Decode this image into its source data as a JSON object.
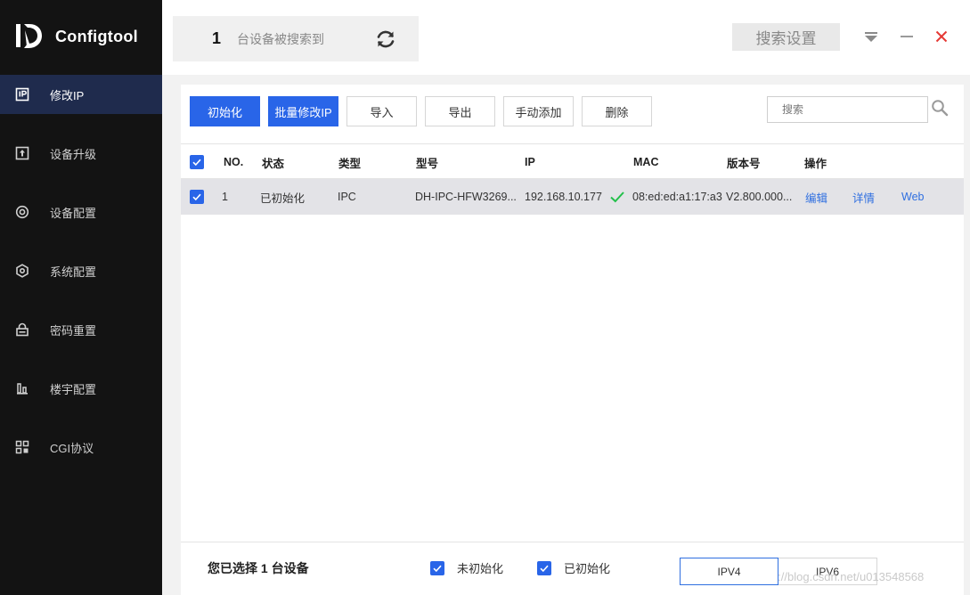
{
  "app": {
    "name": "Configtool"
  },
  "sidebar": {
    "items": [
      {
        "label": "修改IP",
        "icon": "ip-icon",
        "active": true
      },
      {
        "label": "设备升级",
        "icon": "upgrade-icon",
        "active": false
      },
      {
        "label": "设备配置",
        "icon": "target-icon",
        "active": false
      },
      {
        "label": "系统配置",
        "icon": "hexagon-settings-icon",
        "active": false
      },
      {
        "label": "密码重置",
        "icon": "lock-icon",
        "active": false
      },
      {
        "label": "楼宇配置",
        "icon": "building-chart-icon",
        "active": false
      },
      {
        "label": "CGI协议",
        "icon": "grid-protocol-icon",
        "active": false
      }
    ]
  },
  "header": {
    "count": "1",
    "count_text": "台设备被搜索到",
    "search_settings": "搜索设置"
  },
  "toolbar": {
    "buttons": [
      {
        "label": "初始化",
        "primary": true
      },
      {
        "label": "批量修改IP",
        "primary": true
      },
      {
        "label": "导入",
        "primary": false
      },
      {
        "label": "导出",
        "primary": false
      },
      {
        "label": "手动添加",
        "primary": false
      },
      {
        "label": "删除",
        "primary": false
      }
    ],
    "search_placeholder": "搜索"
  },
  "table": {
    "columns": [
      "NO.",
      "状态",
      "类型",
      "型号",
      "IP",
      "MAC",
      "版本号",
      "操作"
    ],
    "rows": [
      {
        "no": "1",
        "status": "已初始化",
        "type": "IPC",
        "model": "DH-IPC-HFW3269...",
        "ip": "192.168.10.177",
        "mac": "08:ed:ed:a1:17:a3",
        "version": "V2.800.000...",
        "actions": [
          "编辑",
          "详情",
          "Web"
        ]
      }
    ]
  },
  "footer": {
    "selected_text": "您已选择 1 台设备",
    "filter_uninit": "未初始化",
    "filter_init": "已初始化",
    "ipv4": "IPV4",
    "ipv6": "IPV6"
  },
  "watermark": "https://blog.csdn.net/u013548568",
  "colors": {
    "accent": "#2965e8",
    "sidebar_bg": "#131313",
    "active_bg": "#1f2b4d",
    "row_bg": "#e3e3e7",
    "link": "#2f6fe0",
    "success": "#22c04a",
    "close": "#e53935"
  }
}
